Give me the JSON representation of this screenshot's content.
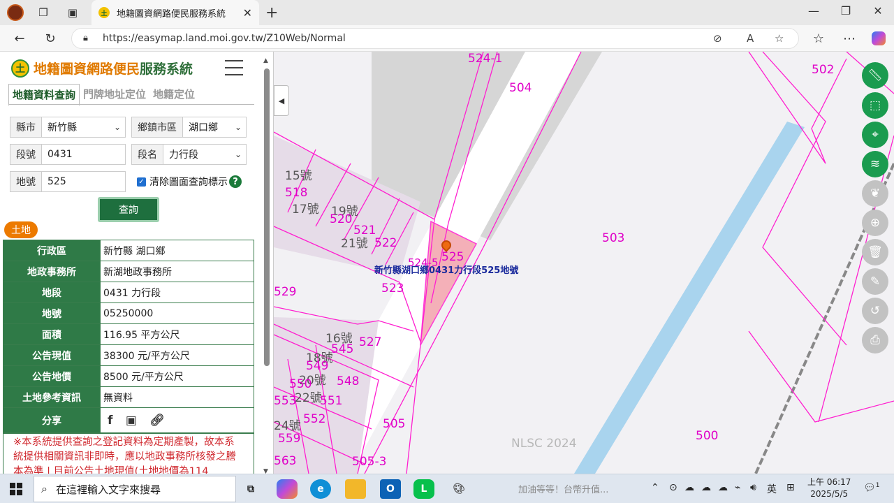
{
  "browser": {
    "tab_title": "地籍圖資網路便民服務系統",
    "tab_favicon": "土",
    "url": "https://easymap.land.moi.gov.tw/Z10Web/Normal"
  },
  "app": {
    "logo_mark": "土",
    "title_part1": "地籍圖資網路便民",
    "title_part2": "服務系統",
    "tabs": [
      "地籍資料查詢",
      "門牌地址定位",
      "地籍定位"
    ]
  },
  "form": {
    "county_label": "縣市",
    "county_value": "新竹縣",
    "township_label": "鄉鎮市區",
    "township_value": "湖口鄉",
    "section_no_label": "段號",
    "section_no_value": "0431",
    "section_name_label": "段名",
    "section_name_value": "力行段",
    "lot_label": "地號",
    "lot_value": "525",
    "clear_checkbox_label": "清除圖面查詢標示",
    "help": "?",
    "query_button": "查詢"
  },
  "result": {
    "badge": "土地",
    "rows": [
      {
        "key": "行政區",
        "value": "新竹縣 湖口鄉"
      },
      {
        "key": "地政事務所",
        "value": "新湖地政事務所"
      },
      {
        "key": "地段",
        "value": "0431 力行段"
      },
      {
        "key": "地號",
        "value": "05250000"
      },
      {
        "key": "面積",
        "value": "116.95 平方公尺"
      },
      {
        "key": "公告現值",
        "value": "38300 元/平方公尺"
      },
      {
        "key": "公告地價",
        "value": "8500 元/平方公尺"
      },
      {
        "key": "土地參考資訊",
        "value": "無資料"
      }
    ],
    "share_label": "分享",
    "share_icons": [
      "facebook-icon",
      "line-icon",
      "link-icon"
    ],
    "note": "※本系統提供查詢之登記資料為定期產製，故本系統提供相關資訊非即時，應以地政事務所核發之謄本為準 | 目前公告土地現值(土地地價為114"
  },
  "map": {
    "marker_label": "新竹縣湖口鄉0431力行段525地號",
    "watermark": "NLSC 2024",
    "parcel_numbers": [
      "524-1",
      "504",
      "502",
      "15號",
      "518",
      "17號",
      "19號",
      "520",
      "521",
      "21號",
      "522",
      "503",
      "529",
      "523",
      "524-5",
      "525",
      "16號",
      "545",
      "527",
      "18號",
      "549",
      "20號",
      "550",
      "548",
      "22號",
      "553",
      "551",
      "24號",
      "552",
      "559",
      "505",
      "500",
      "505-3",
      "563"
    ],
    "tools": [
      "ruler-icon",
      "select-icon",
      "locate-pin-icon",
      "layers-icon",
      "leaf-icon",
      "target-icon",
      "trash-icon",
      "edit-icon",
      "history-icon",
      "print-icon"
    ]
  },
  "taskbar": {
    "search_placeholder": "在這裡輸入文字來搜尋",
    "news": "加油等等！台幣升值...",
    "ime": "英",
    "time": "上午 06:17",
    "date": "2025/5/5",
    "notification_count": "1"
  }
}
